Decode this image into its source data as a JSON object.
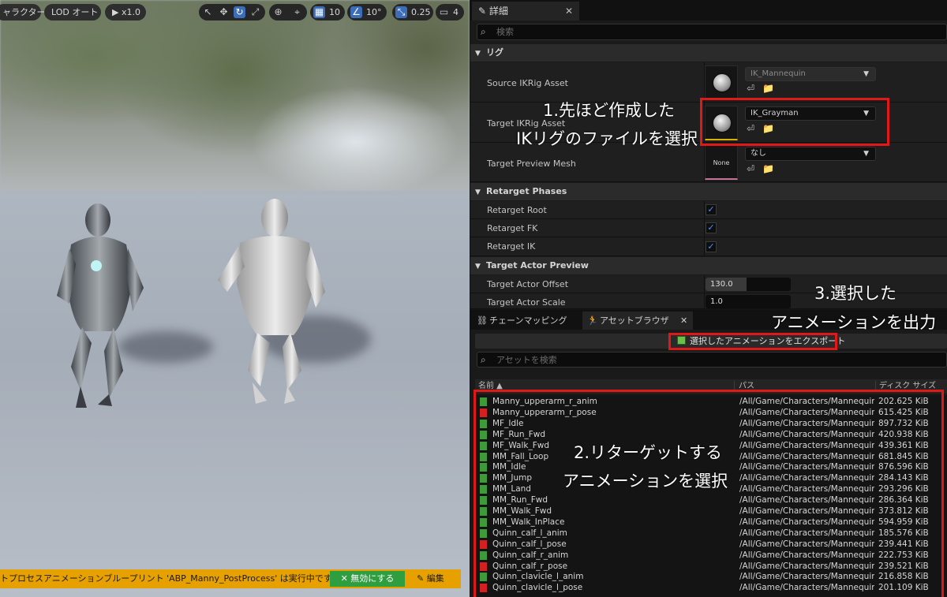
{
  "viewport": {
    "toolbar": {
      "character_btn": "ャラクター",
      "lod_btn": "LOD オート",
      "speed_btn": "x1.0",
      "grid_value": "10",
      "angle_value": "10°",
      "scale_value": "0.25",
      "camera_value": "4"
    },
    "warning": {
      "text": "トプロセスアニメーションブループリント 'ABP_Manny_PostProcess' は実行中です。",
      "disable_button": "無効にする",
      "edit_button": "編集"
    }
  },
  "details": {
    "tab_title": "詳細",
    "search_placeholder": "検索",
    "categories": {
      "rig": "リグ",
      "retarget_phases": "Retarget Phases",
      "target_actor_preview": "Target Actor Preview"
    },
    "rig": {
      "source_label": "Source IKRig Asset",
      "source_value": "IK_Mannequin",
      "target_label": "Target IKRig Asset",
      "target_value": "IK_Grayman",
      "preview_mesh_label": "Target Preview Mesh",
      "preview_mesh_value": "なし",
      "preview_mesh_thumb": "None"
    },
    "phases": {
      "root_label": "Retarget Root",
      "root_checked": true,
      "fk_label": "Retarget FK",
      "fk_checked": true,
      "ik_label": "Retarget IK",
      "ik_checked": true
    },
    "actor_preview": {
      "offset_label": "Target Actor Offset",
      "offset_value": "130.0",
      "scale_label": "Target Actor Scale",
      "scale_value": "1.0"
    }
  },
  "asset_browser": {
    "tabs": [
      "チェーンマッピング",
      "アセットブラウザ"
    ],
    "export_button": "選択したアニメーションをエクスポート",
    "search_placeholder": "アセットを検索",
    "columns": {
      "name": "名前 ▲",
      "path": "パス",
      "size": "ディスク サイズ"
    },
    "rows": [
      {
        "name": "Manny_upperarm_r_anim",
        "type": "anim",
        "path": "/All/Game/Characters/Mannequins",
        "size": "202.625 KiB"
      },
      {
        "name": "Manny_upperarm_r_pose",
        "type": "pose",
        "path": "/All/Game/Characters/Mannequins",
        "size": "615.425 KiB"
      },
      {
        "name": "MF_Idle",
        "type": "anim",
        "path": "/All/Game/Characters/Mannequins",
        "size": "897.732 KiB"
      },
      {
        "name": "MF_Run_Fwd",
        "type": "anim",
        "path": "/All/Game/Characters/Mannequins",
        "size": "420.938 KiB"
      },
      {
        "name": "MF_Walk_Fwd",
        "type": "anim",
        "path": "/All/Game/Characters/Mannequins",
        "size": "439.361 KiB"
      },
      {
        "name": "MM_Fall_Loop",
        "type": "anim",
        "path": "/All/Game/Characters/Mannequins",
        "size": "681.845 KiB"
      },
      {
        "name": "MM_Idle",
        "type": "anim",
        "path": "/All/Game/Characters/Mannequins",
        "size": "876.596 KiB"
      },
      {
        "name": "MM_Jump",
        "type": "anim",
        "path": "/All/Game/Characters/Mannequins",
        "size": "284.143 KiB"
      },
      {
        "name": "MM_Land",
        "type": "anim",
        "path": "/All/Game/Characters/Mannequins",
        "size": "293.296 KiB"
      },
      {
        "name": "MM_Run_Fwd",
        "type": "anim",
        "path": "/All/Game/Characters/Mannequins",
        "size": "286.364 KiB"
      },
      {
        "name": "MM_Walk_Fwd",
        "type": "anim",
        "path": "/All/Game/Characters/Mannequins",
        "size": "373.812 KiB"
      },
      {
        "name": "MM_Walk_InPlace",
        "type": "anim",
        "path": "/All/Game/Characters/Mannequins",
        "size": "594.959 KiB"
      },
      {
        "name": "Quinn_calf_l_anim",
        "type": "anim",
        "path": "/All/Game/Characters/Mannequins",
        "size": "185.576 KiB"
      },
      {
        "name": "Quinn_calf_l_pose",
        "type": "pose",
        "path": "/All/Game/Characters/Mannequins",
        "size": "239.441 KiB"
      },
      {
        "name": "Quinn_calf_r_anim",
        "type": "anim",
        "path": "/All/Game/Characters/Mannequins",
        "size": "222.753 KiB"
      },
      {
        "name": "Quinn_calf_r_pose",
        "type": "pose",
        "path": "/All/Game/Characters/Mannequins",
        "size": "239.521 KiB"
      },
      {
        "name": "Quinn_clavicle_l_anim",
        "type": "anim",
        "path": "/All/Game/Characters/Mannequins",
        "size": "216.858 KiB"
      },
      {
        "name": "Quinn_clavicle_l_pose",
        "type": "pose",
        "path": "/All/Game/Characters/Mannequins",
        "size": "201.109 KiB"
      }
    ]
  },
  "annotations": {
    "note1_line1": "1.先ほど作成した",
    "note1_line2": "IKリグのファイルを選択",
    "note2_line1": "2.リターゲットする",
    "note2_line2": "アニメーションを選択",
    "note3_line1": "3.選択した",
    "note3_line2": "アニメーションを出力"
  },
  "colors": {
    "anim_icon": "#3f9b3a",
    "pose_icon": "#d42020",
    "annotation_box": "#e01818",
    "warning_bar": "#e6a100"
  }
}
